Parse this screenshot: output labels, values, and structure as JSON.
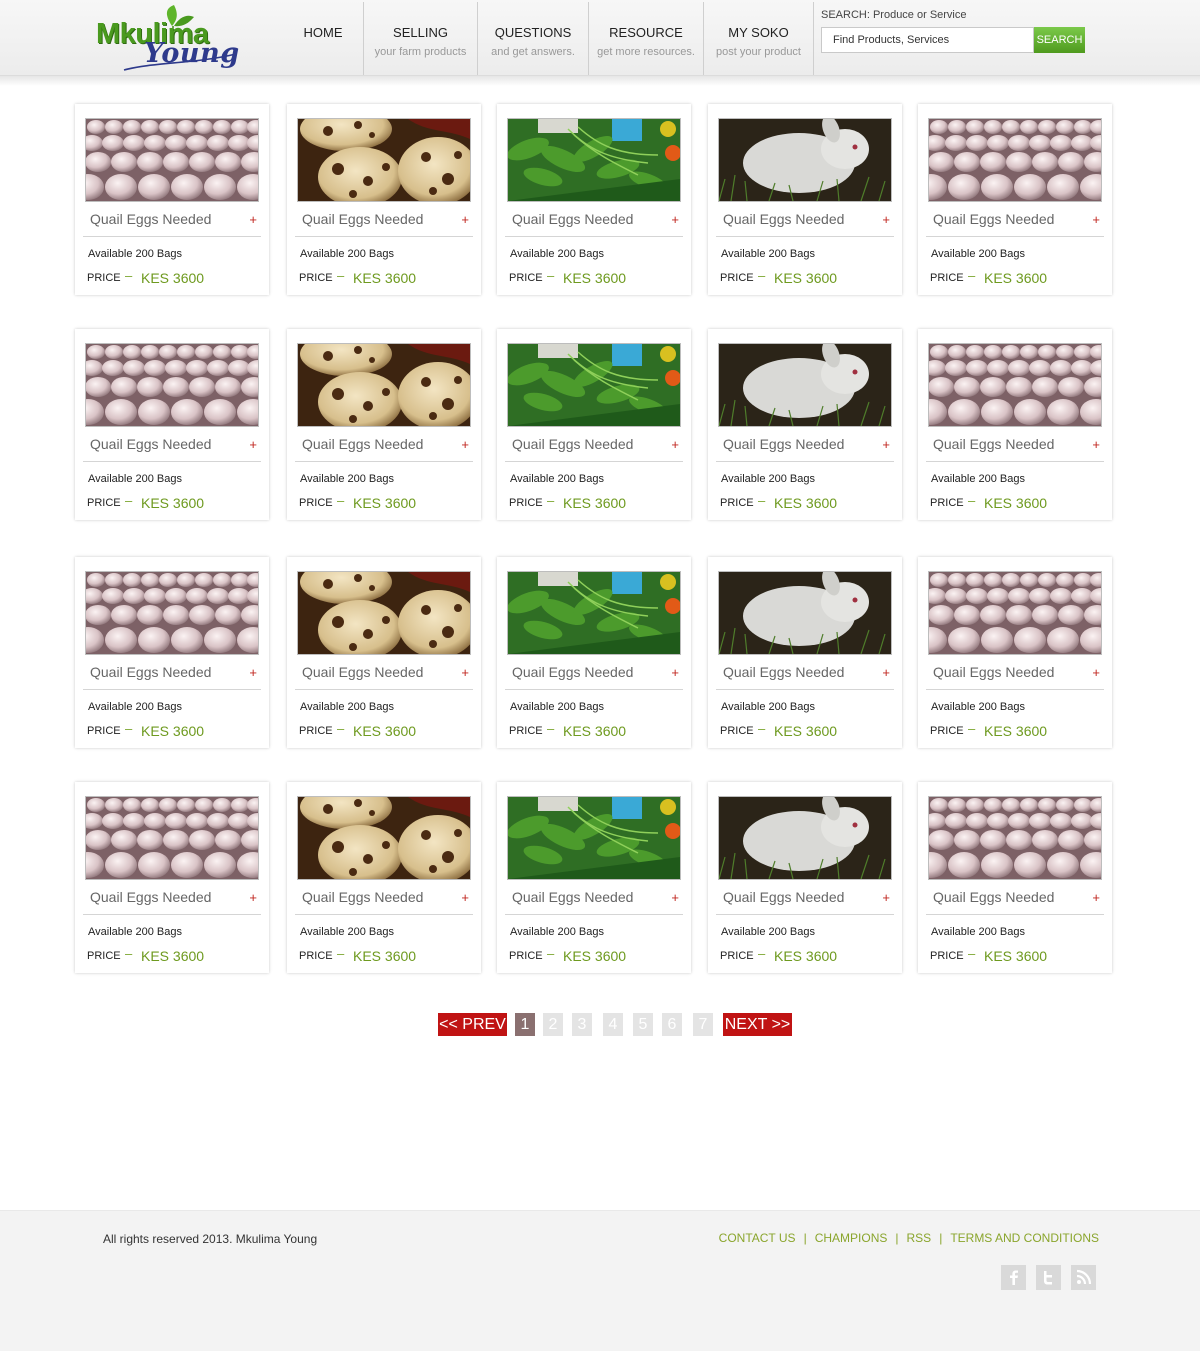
{
  "logo": {
    "line1": "Mkulima",
    "line2": "Young"
  },
  "nav": [
    {
      "label": "HOME",
      "sub": ""
    },
    {
      "label": "SELLING",
      "sub": "your farm products"
    },
    {
      "label": "QUESTIONS",
      "sub": "and get answers."
    },
    {
      "label": "RESOURCE",
      "sub": "get more resources."
    },
    {
      "label": "MY SOKO",
      "sub": "post your product"
    }
  ],
  "search": {
    "label": "SEARCH: Produce or Service",
    "placeholder": "Find Products, Services",
    "button": "SEARCH"
  },
  "listings": [
    {
      "image": "eggs-tray-image",
      "title": "Quail Eggs Needed",
      "availability": "Available 200 Bags",
      "price_label": "PRICE",
      "price": "KES 3600"
    },
    {
      "image": "quail-eggs-image",
      "title": "Quail Eggs Needed",
      "availability": "Available 200 Bags",
      "price_label": "PRICE",
      "price": "KES 3600"
    },
    {
      "image": "vegetables-image",
      "title": "Quail Eggs Needed",
      "availability": "Available 200 Bags",
      "price_label": "PRICE",
      "price": "KES 3600"
    },
    {
      "image": "rabbit-image",
      "title": "Quail Eggs Needed",
      "availability": "Available 200 Bags",
      "price_label": "PRICE",
      "price": "KES 3600"
    },
    {
      "image": "eggs-tray-image",
      "title": "Quail Eggs Needed",
      "availability": "Available 200 Bags",
      "price_label": "PRICE",
      "price": "KES 3600"
    },
    {
      "image": "eggs-tray-image",
      "title": "Quail Eggs Needed",
      "availability": "Available 200 Bags",
      "price_label": "PRICE",
      "price": "KES 3600"
    },
    {
      "image": "quail-eggs-image",
      "title": "Quail Eggs Needed",
      "availability": "Available 200 Bags",
      "price_label": "PRICE",
      "price": "KES 3600"
    },
    {
      "image": "vegetables-image",
      "title": "Quail Eggs Needed",
      "availability": "Available 200 Bags",
      "price_label": "PRICE",
      "price": "KES 3600"
    },
    {
      "image": "rabbit-image",
      "title": "Quail Eggs Needed",
      "availability": "Available 200 Bags",
      "price_label": "PRICE",
      "price": "KES 3600"
    },
    {
      "image": "eggs-tray-image",
      "title": "Quail Eggs Needed",
      "availability": "Available 200 Bags",
      "price_label": "PRICE",
      "price": "KES 3600"
    },
    {
      "image": "eggs-tray-image",
      "title": "Quail Eggs Needed",
      "availability": "Available 200 Bags",
      "price_label": "PRICE",
      "price": "KES 3600"
    },
    {
      "image": "quail-eggs-image",
      "title": "Quail Eggs Needed",
      "availability": "Available 200 Bags",
      "price_label": "PRICE",
      "price": "KES 3600"
    },
    {
      "image": "vegetables-image",
      "title": "Quail Eggs Needed",
      "availability": "Available 200 Bags",
      "price_label": "PRICE",
      "price": "KES 3600"
    },
    {
      "image": "rabbit-image",
      "title": "Quail Eggs Needed",
      "availability": "Available 200 Bags",
      "price_label": "PRICE",
      "price": "KES 3600"
    },
    {
      "image": "eggs-tray-image",
      "title": "Quail Eggs Needed",
      "availability": "Available 200 Bags",
      "price_label": "PRICE",
      "price": "KES 3600"
    },
    {
      "image": "eggs-tray-image",
      "title": "Quail Eggs Needed",
      "availability": "Available 200 Bags",
      "price_label": "PRICE",
      "price": "KES 3600"
    },
    {
      "image": "quail-eggs-image",
      "title": "Quail Eggs Needed",
      "availability": "Available 200 Bags",
      "price_label": "PRICE",
      "price": "KES 3600"
    },
    {
      "image": "vegetables-image",
      "title": "Quail Eggs Needed",
      "availability": "Available 200 Bags",
      "price_label": "PRICE",
      "price": "KES 3600"
    },
    {
      "image": "rabbit-image",
      "title": "Quail Eggs Needed",
      "availability": "Available 200 Bags",
      "price_label": "PRICE",
      "price": "KES 3600"
    },
    {
      "image": "eggs-tray-image",
      "title": "Quail Eggs Needed",
      "availability": "Available 200 Bags",
      "price_label": "PRICE",
      "price": "KES 3600"
    }
  ],
  "pagination": {
    "prev": "<< PREV",
    "next": "NEXT >>",
    "pages": [
      "1",
      "2",
      "3",
      "4",
      "5",
      "6",
      "7"
    ],
    "current": "1"
  },
  "footer": {
    "copyright": "All rights reserved 2013. Mkulima Young",
    "links": [
      "CONTACT US",
      "CHAMPIONS",
      "RSS",
      "TERMS AND CONDITIONS"
    ],
    "separator": "|",
    "social": [
      "facebook-icon",
      "twitter-icon",
      "rss-icon"
    ]
  },
  "colors": {
    "brand_green": "#4a9a1f",
    "brand_blue": "#2e3a8c",
    "price_green": "#6e9a1f",
    "link_green": "#8aa52c",
    "pager_red": "#c01313",
    "plus_red": "#c0261f"
  }
}
